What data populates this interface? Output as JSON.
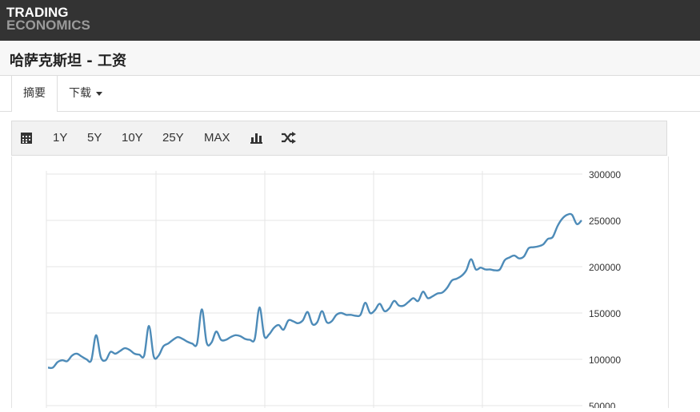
{
  "header": {
    "logo_line1": "TRADING",
    "logo_line2": "ECONOMICS"
  },
  "page": {
    "title": "哈萨克斯坦 - 工资"
  },
  "tabs": [
    {
      "label": "摘要",
      "active": true
    },
    {
      "label": "下载",
      "active": false
    }
  ],
  "toolbar": {
    "calendar_icon": "calendar-icon",
    "ranges": [
      "1Y",
      "5Y",
      "10Y",
      "25Y",
      "MAX"
    ],
    "chart_type_icon": "bar-chart-icon",
    "compare_icon": "shuffle-icon"
  },
  "colors": {
    "line": "#4d8bb8",
    "grid": "#e6e6e6",
    "topbar": "#333333"
  },
  "chart_data": {
    "type": "line",
    "title": "",
    "xlabel": "",
    "ylabel": "",
    "ylim": [
      50000,
      300000
    ],
    "yticks": [
      50000,
      100000,
      150000,
      200000,
      250000,
      300000
    ],
    "ytick_labels": [
      "50000",
      "100000",
      "150000",
      "200000",
      "250000",
      "300000"
    ],
    "grid": true,
    "series": [
      {
        "values": [
          91000,
          91000,
          97000,
          99000,
          98000,
          104000,
          106000,
          103000,
          100000,
          99000,
          126000,
          102000,
          99000,
          108000,
          106000,
          109000,
          112000,
          110000,
          106000,
          105000,
          104000,
          136000,
          103000,
          104000,
          114000,
          117000,
          121000,
          124000,
          122000,
          119000,
          117000,
          117000,
          154000,
          118000,
          118000,
          130000,
          121000,
          121000,
          124000,
          126000,
          125000,
          122000,
          121000,
          122000,
          156000,
          125000,
          127000,
          134000,
          137000,
          132000,
          142000,
          141000,
          139000,
          142000,
          151000,
          138000,
          140000,
          152000,
          140000,
          141000,
          148000,
          150000,
          148000,
          148000,
          147000,
          148000,
          161000,
          150000,
          153000,
          160000,
          152000,
          155000,
          163000,
          158000,
          158000,
          162000,
          166000,
          163000,
          173000,
          166000,
          168000,
          171000,
          172000,
          177000,
          185000,
          187000,
          190000,
          196000,
          208000,
          197000,
          199000,
          197000,
          197000,
          196000,
          197000,
          207000,
          210000,
          212000,
          209000,
          211000,
          220000,
          221000,
          222000,
          224000,
          230000,
          232000,
          244000,
          252000,
          256000,
          256000,
          246000,
          250000
        ]
      }
    ]
  }
}
